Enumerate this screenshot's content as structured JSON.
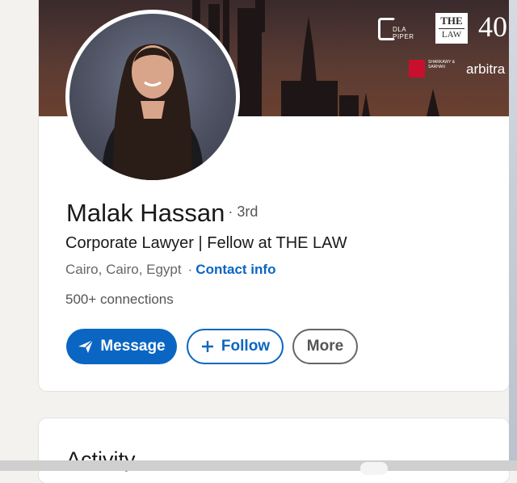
{
  "profile": {
    "name": "Malak Hassan",
    "degree": "3rd",
    "headline": "Corporate Lawyer | Fellow at THE LAW",
    "location": "Cairo, Cairo, Egypt",
    "contact_info": "Contact info",
    "connections_count": "500+",
    "connections_label": "connections"
  },
  "banner": {
    "logo1": "DLA PIPER",
    "logo2_line1": "THE",
    "logo2_line2": "LAW",
    "logo3": "40",
    "logo4": "SHARKAWY & SARHAN",
    "logo5": "arbitra"
  },
  "actions": {
    "message": "Message",
    "follow": "Follow",
    "more": "More"
  },
  "activity": {
    "title": "Activity"
  },
  "colors": {
    "accent": "#0a66c2",
    "background": "#f3f2ef"
  }
}
